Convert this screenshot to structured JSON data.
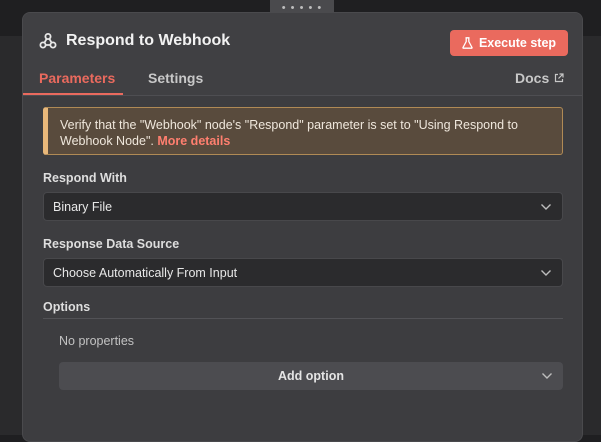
{
  "drag_handle": "::::: ",
  "header": {
    "title": "Respond to Webhook",
    "execute_label": "Execute step",
    "icon": "webhook-icon"
  },
  "tabs": [
    {
      "label": "Parameters",
      "active": true
    },
    {
      "label": "Settings",
      "active": false
    }
  ],
  "docs_label": "Docs",
  "notice": {
    "text": "Verify that the \"Webhook\" node's \"Respond\" parameter is set to \"Using Respond to Webhook Node\".",
    "link": "More details"
  },
  "fields": {
    "respond_with": {
      "label": "Respond With",
      "value": "Binary File"
    },
    "response_source": {
      "label": "Response Data Source",
      "value": "Choose Automatically From Input"
    }
  },
  "options": {
    "label": "Options",
    "empty_text": "No properties",
    "add_label": "Add option"
  },
  "colors": {
    "accent": "#ea6a5e",
    "panel": "#3d3d40",
    "notice_bg": "#594b3d",
    "notice_border": "#e9b87a"
  }
}
